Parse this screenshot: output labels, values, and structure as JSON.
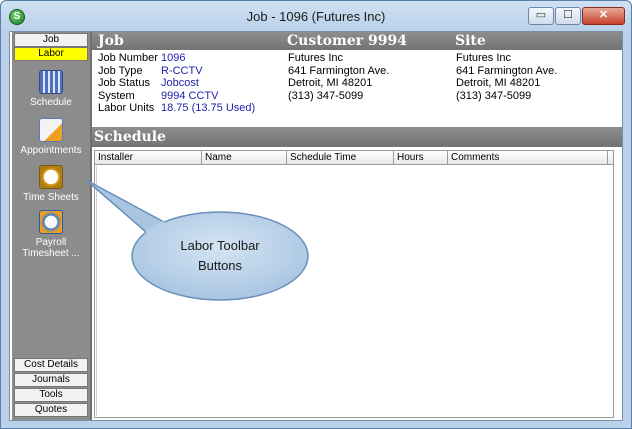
{
  "window": {
    "title": "Job - 1096 (Futures  Inc)",
    "app_icon_letter": "S",
    "minimize": "▭",
    "maximize": "☐",
    "close": "✕"
  },
  "sidebar": {
    "top_tabs": [
      {
        "label": "Job",
        "active": false
      },
      {
        "label": "Labor",
        "active": true
      }
    ],
    "tools": [
      {
        "label": "Schedule",
        "icon": "schedule-icon"
      },
      {
        "label": "Appointments",
        "icon": "appointments-icon"
      },
      {
        "label": "Time Sheets",
        "icon": "clock-icon"
      },
      {
        "label": "Payroll Timesheet ...",
        "icon": "payroll-icon"
      }
    ],
    "bottom_tabs": [
      {
        "label": "Cost Details"
      },
      {
        "label": "Journals"
      },
      {
        "label": "Tools"
      },
      {
        "label": "Quotes"
      }
    ]
  },
  "job_header": {
    "job": "Job",
    "customer": "Customer 9994",
    "site": "Site"
  },
  "job_info": {
    "job_number_label": "Job Number",
    "job_number": "1096",
    "job_type_label": "Job Type",
    "job_type": "R-CCTV",
    "job_status_label": "Job Status",
    "job_status": "Jobcost",
    "system_label": "System",
    "system": "9994 CCTV",
    "labor_units_label": "Labor Units",
    "labor_units": "18.75 (13.75 Used)"
  },
  "customer": {
    "name": "Futures  Inc",
    "address": "641 Farmington Ave.",
    "city": "Detroit, MI  48201",
    "phone": "(313) 347-5099"
  },
  "site": {
    "name": "Futures  Inc",
    "address": "641 Farmington Ave.",
    "city": "Detroit, MI  48201",
    "phone": "(313) 347-5099"
  },
  "schedule": {
    "title": "Schedule",
    "columns": [
      "Installer",
      "Name",
      "Schedule Time",
      "Hours",
      "Comments"
    ],
    "rows": []
  },
  "callout": {
    "line1": "Labor Toolbar",
    "line2": "Buttons"
  },
  "colors": {
    "active_tab": "#ffff00",
    "section_bar": "#808080",
    "value_text": "#2222aa",
    "callout_fill": "#bcd4ea"
  }
}
